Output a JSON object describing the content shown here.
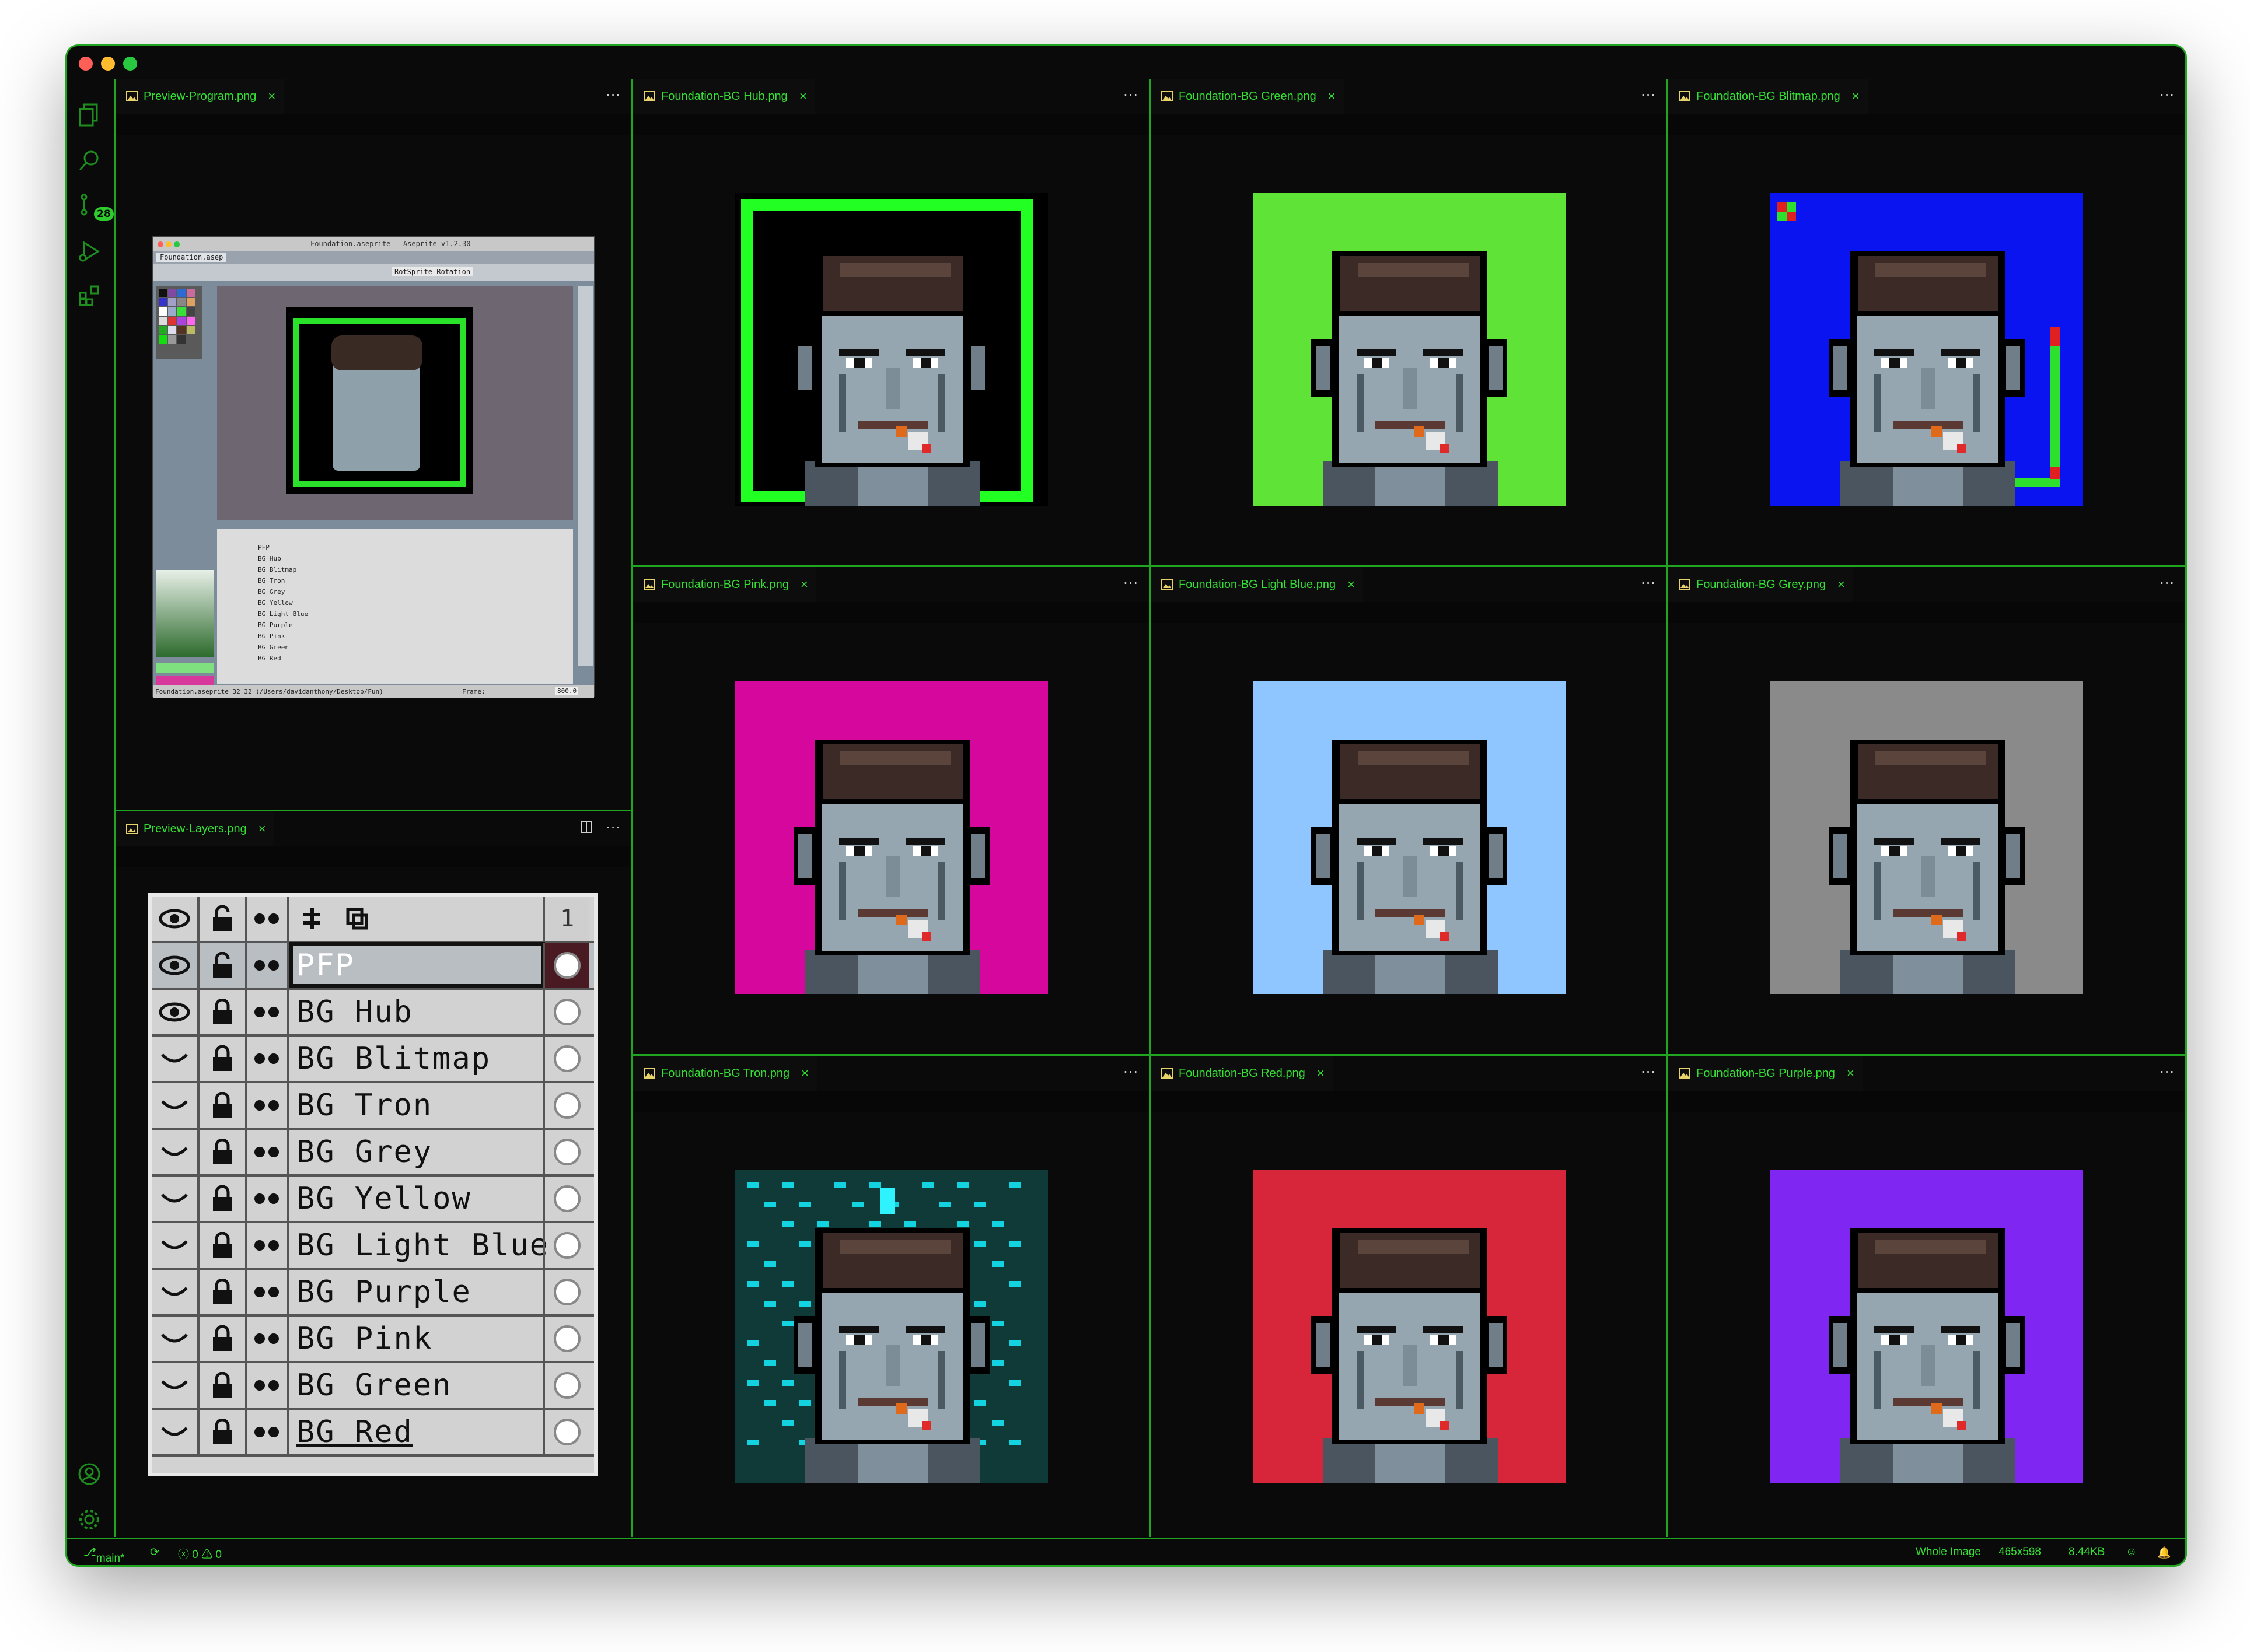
{
  "window": {
    "traffic_lights": {
      "close": "#ff5f57",
      "minimize": "#febc2e",
      "zoom": "#28c840"
    },
    "accent_color": "#2ecc2e"
  },
  "activity_bar": {
    "items": [
      "files-icon",
      "search-icon",
      "source-control-icon",
      "run-debug-icon",
      "extensions-icon"
    ],
    "scm_badge": "28",
    "bottom_items": [
      "account-icon",
      "settings-gear-icon"
    ]
  },
  "panes": {
    "preview_program": {
      "tab": "Preview-Program.png"
    },
    "preview_layers": {
      "tab": "Preview-Layers.png"
    },
    "bg_hub": {
      "tab": "Foundation-BG Hub.png",
      "background": "#000000",
      "frame": "#22ff22"
    },
    "bg_green": {
      "tab": "Foundation-BG Green.png",
      "background": "#5fe336"
    },
    "bg_blitmap": {
      "tab": "Foundation-BG Blitmap.png",
      "background": "#0a14f0"
    },
    "bg_pink": {
      "tab": "Foundation-BG Pink.png",
      "background": "#d6079c"
    },
    "bg_light_blue": {
      "tab": "Foundation-BG Light Blue.png",
      "background": "#8fc6ff"
    },
    "bg_grey": {
      "tab": "Foundation-BG Grey.png",
      "background": "#8a8a8a"
    },
    "bg_tron": {
      "tab": "Foundation-BG Tron.png",
      "background": "#0f3a38"
    },
    "bg_red": {
      "tab": "Foundation-BG Red.png",
      "background": "#d7263a"
    },
    "bg_purple": {
      "tab": "Foundation-BG Purple.png",
      "background": "#7f26f2"
    }
  },
  "mini_app": {
    "title": "Foundation.aseprite - Aseprite v1.2.30",
    "tab": "Foundation.asep",
    "rotation_label": "RotSprite Rotation",
    "layer_names": [
      "PFP",
      "BG Hub",
      "BG Blitmap",
      "BG Tron",
      "BG Grey",
      "BG Yellow",
      "BG Light Blue",
      "BG Purple",
      "BG Pink",
      "BG Green",
      "BG Red"
    ],
    "status_path": "Foundation.aseprite  32 32  (/Users/davidanthony/Desktop/Fun)",
    "frame_label": "Frame:",
    "zoom": "800.0"
  },
  "layers_panel": {
    "frame_number": "1",
    "layers": [
      "PFP",
      "BG Hub",
      "BG Blitmap",
      "BG Tron",
      "BG Grey",
      "BG Yellow",
      "BG Light Blue",
      "BG Purple",
      "BG Pink",
      "BG Green",
      "BG Red"
    ]
  },
  "status_bar": {
    "branch": "main*",
    "problems": "ⓧ 0 ⚠ 0",
    "zoom_mode": "Whole Image",
    "dimensions": "465x598",
    "file_size": "8.44KB"
  }
}
